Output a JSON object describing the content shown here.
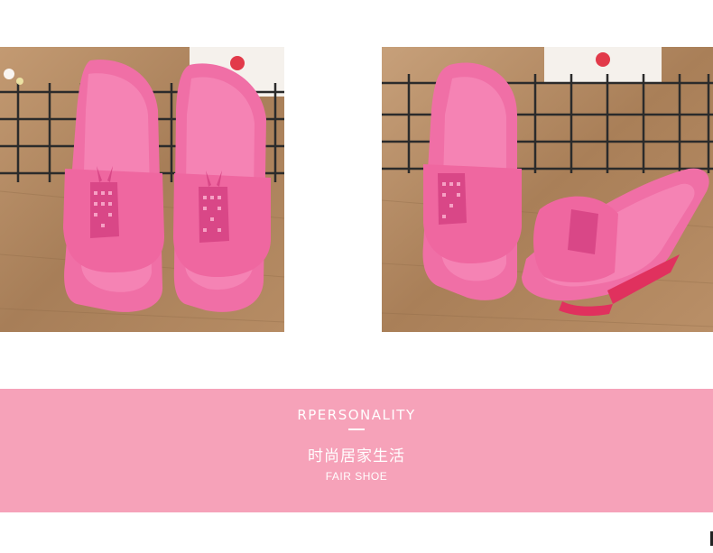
{
  "photos": [
    {
      "name": "slippers-front-view",
      "subject": "pink slippers pair, front view"
    },
    {
      "name": "slippers-side-view",
      "subject": "pink slippers pair, angled view"
    }
  ],
  "banner": {
    "title": "RPERSONALITY",
    "subtitle_cn": "时尚居家生活",
    "subtitle_en": "FAIR SHOE",
    "background": "#f6a2b9",
    "text_color": "#ffffff"
  },
  "colors": {
    "slipper_pink": "#f06fa6",
    "slipper_dark": "#d94787",
    "floor_wood": "#b58a63",
    "wall": "#f3efe9"
  }
}
